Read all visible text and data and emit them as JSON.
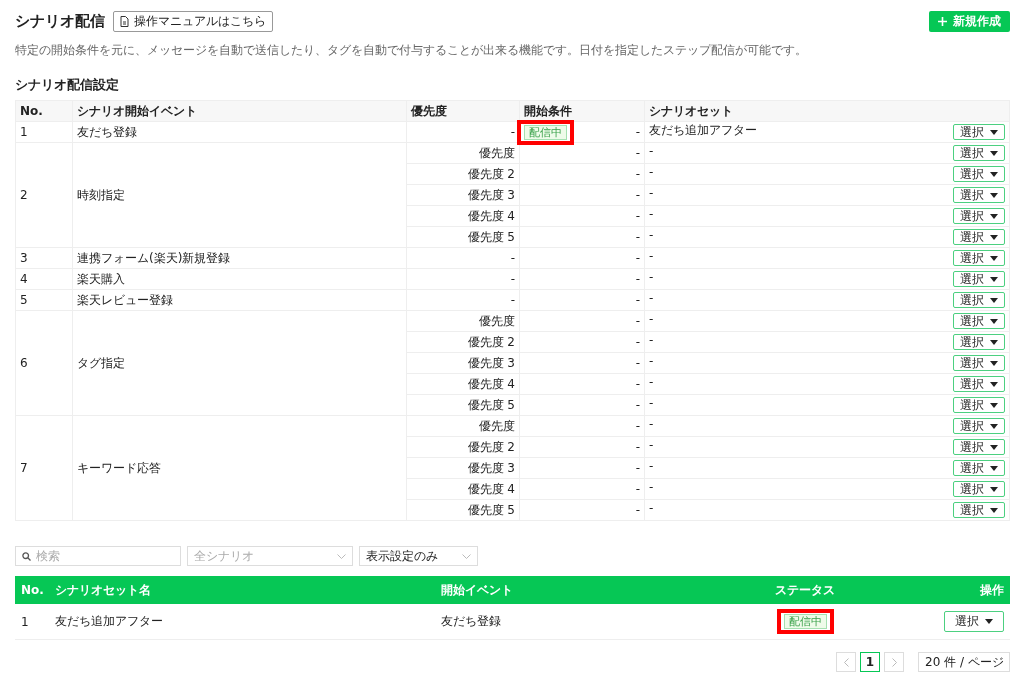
{
  "header": {
    "title": "シナリオ配信",
    "manual_button": "操作マニュアルはこちら",
    "create_button": "新規作成"
  },
  "description": "特定の開始条件を元に、メッセージを自動で送信したり、タグを自動で付与することが出来る機能です。日付を指定したステップ配信が可能です。",
  "settings": {
    "title": "シナリオ配信設定",
    "columns": [
      "No.",
      "シナリオ開始イベント",
      "優先度",
      "開始条件",
      "シナリオセット"
    ],
    "events": [
      {
        "no": "1",
        "name": "友だち登録",
        "rows": [
          {
            "priority": "-",
            "condition": "-",
            "status": "配信中",
            "highlighted": true,
            "scenario_set": "友だち追加アフター",
            "action": "選択"
          }
        ]
      },
      {
        "no": "2",
        "name": "時刻指定",
        "rows": [
          {
            "priority": "優先度",
            "condition": "-",
            "scenario_set": "-",
            "action": "選択"
          },
          {
            "priority": "優先度 2",
            "condition": "-",
            "scenario_set": "-",
            "action": "選択"
          },
          {
            "priority": "優先度 3",
            "condition": "-",
            "scenario_set": "-",
            "action": "選択"
          },
          {
            "priority": "優先度 4",
            "condition": "-",
            "scenario_set": "-",
            "action": "選択"
          },
          {
            "priority": "優先度 5",
            "condition": "-",
            "scenario_set": "-",
            "action": "選択"
          }
        ]
      },
      {
        "no": "3",
        "name": "連携フォーム(楽天)新規登録",
        "rows": [
          {
            "priority": "-",
            "condition": "-",
            "scenario_set": "-",
            "action": "選択"
          }
        ]
      },
      {
        "no": "4",
        "name": "楽天購入",
        "rows": [
          {
            "priority": "-",
            "condition": "-",
            "scenario_set": "-",
            "action": "選択"
          }
        ]
      },
      {
        "no": "5",
        "name": "楽天レビュー登録",
        "rows": [
          {
            "priority": "-",
            "condition": "-",
            "scenario_set": "-",
            "action": "選択"
          }
        ]
      },
      {
        "no": "6",
        "name": "タグ指定",
        "rows": [
          {
            "priority": "優先度",
            "condition": "-",
            "scenario_set": "-",
            "action": "選択"
          },
          {
            "priority": "優先度 2",
            "condition": "-",
            "scenario_set": "-",
            "action": "選択"
          },
          {
            "priority": "優先度 3",
            "condition": "-",
            "scenario_set": "-",
            "action": "選択"
          },
          {
            "priority": "優先度 4",
            "condition": "-",
            "scenario_set": "-",
            "action": "選択"
          },
          {
            "priority": "優先度 5",
            "condition": "-",
            "scenario_set": "-",
            "action": "選択"
          }
        ]
      },
      {
        "no": "7",
        "name": "キーワード応答",
        "rows": [
          {
            "priority": "優先度",
            "condition": "-",
            "scenario_set": "-",
            "action": "選択"
          },
          {
            "priority": "優先度 2",
            "condition": "-",
            "scenario_set": "-",
            "action": "選択"
          },
          {
            "priority": "優先度 3",
            "condition": "-",
            "scenario_set": "-",
            "action": "選択"
          },
          {
            "priority": "優先度 4",
            "condition": "-",
            "scenario_set": "-",
            "action": "選択"
          },
          {
            "priority": "優先度 5",
            "condition": "-",
            "scenario_set": "-",
            "action": "選択"
          }
        ]
      }
    ]
  },
  "filters": {
    "search": {
      "placeholder": "検索"
    },
    "scenario_select": {
      "placeholder": "全シナリオ"
    },
    "display_select": {
      "value": "表示設定のみ"
    }
  },
  "sets": {
    "columns": [
      "No.",
      "シナリオセット名",
      "開始イベント",
      "ステータス",
      "操作"
    ],
    "rows": [
      {
        "no": "1",
        "name": "友だち追加アフター",
        "event": "友だち登録",
        "status": "配信中",
        "highlighted": true,
        "action": "選択"
      }
    ]
  },
  "pagination": {
    "pages": [
      {
        "label": "1",
        "selected": true
      }
    ],
    "page_size": "20 件 / ページ"
  }
}
